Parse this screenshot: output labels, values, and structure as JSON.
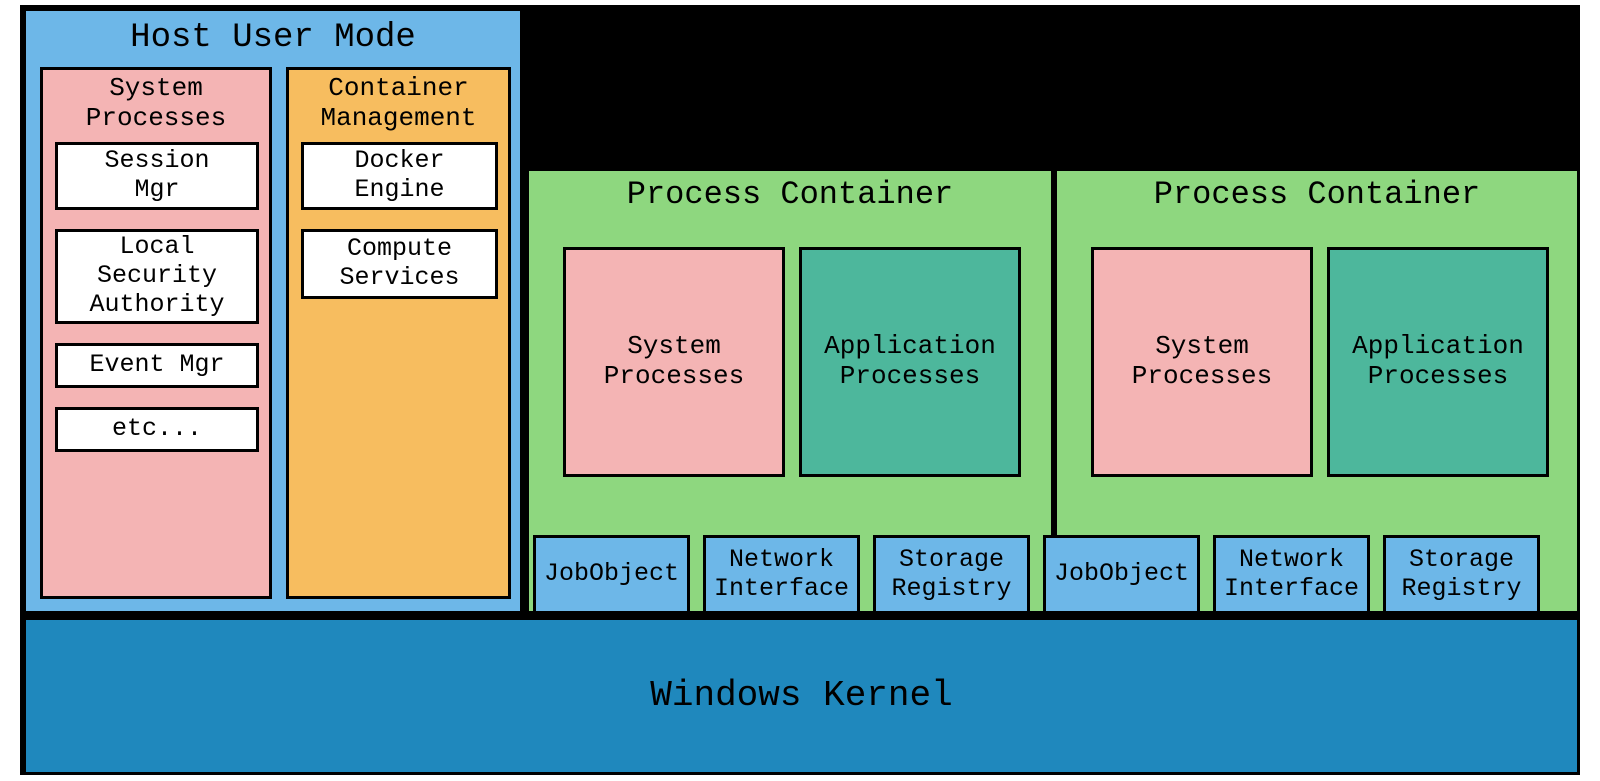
{
  "host": {
    "title": "Host User Mode",
    "system_processes": {
      "title": "System\nProcesses",
      "items": [
        "Session\nMgr",
        "Local\nSecurity\nAuthority",
        "Event Mgr",
        "etc..."
      ]
    },
    "container_management": {
      "title": "Container\nManagement",
      "items": [
        "Docker\nEngine",
        "Compute\nServices"
      ]
    }
  },
  "process_containers": [
    {
      "title": "Process Container",
      "system_processes_label": "System\nProcesses",
      "application_processes_label": "Application\nProcesses",
      "services": [
        "JobObject",
        "Network\nInterface",
        "Storage\nRegistry"
      ]
    },
    {
      "title": "Process Container",
      "system_processes_label": "System\nProcesses",
      "application_processes_label": "Application\nProcesses",
      "services": [
        "JobObject",
        "Network\nInterface",
        "Storage\nRegistry"
      ]
    }
  ],
  "kernel": {
    "label": "Windows Kernel"
  }
}
